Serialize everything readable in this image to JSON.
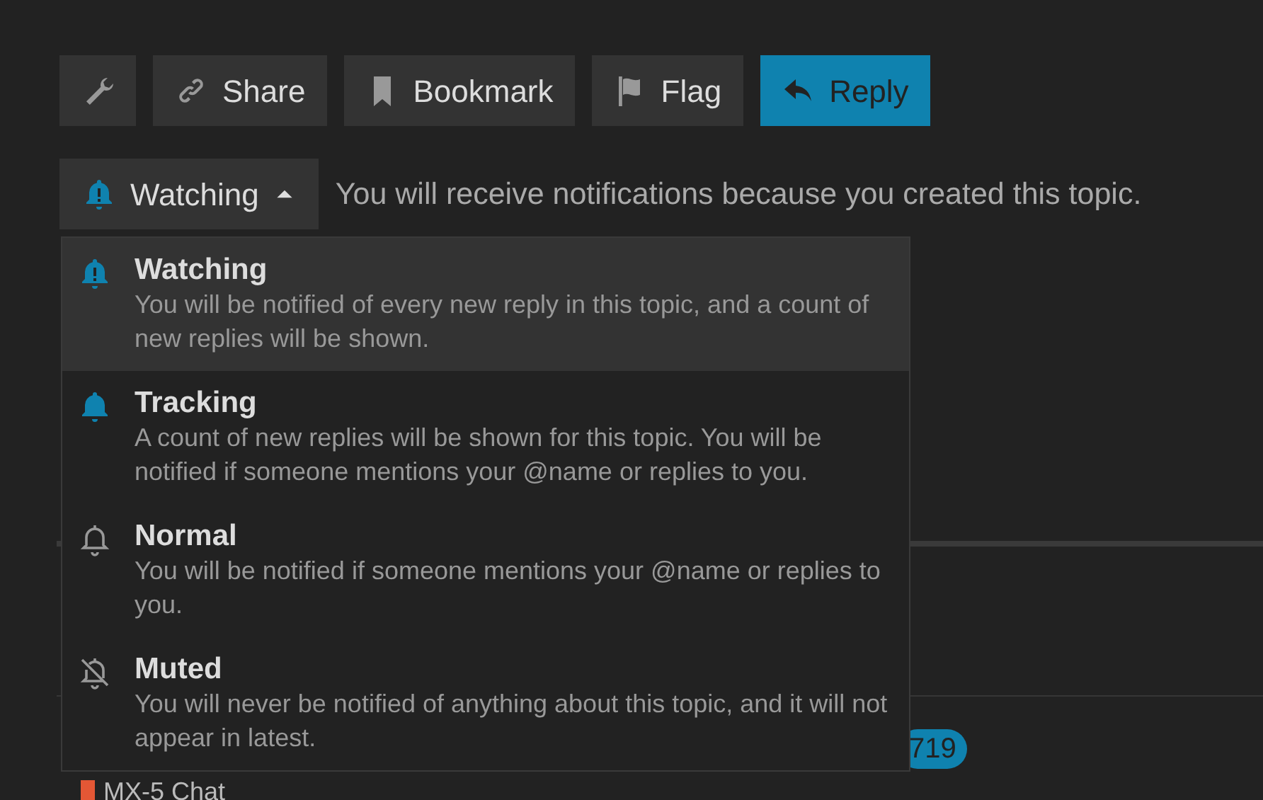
{
  "actions": [
    {
      "kind": "tools",
      "primary": false
    },
    {
      "kind": "share",
      "label": "Share",
      "primary": false
    },
    {
      "kind": "bookmark",
      "label": "Bookmark",
      "primary": false
    },
    {
      "kind": "flag",
      "label": "Flag",
      "primary": false
    },
    {
      "kind": "reply",
      "label": "Reply",
      "primary": true
    }
  ],
  "notifications": {
    "button": {
      "kind": "watching",
      "label": "Watching",
      "expanded": true
    },
    "reason": "You will receive notifications because you created this topic.",
    "menu": [
      {
        "kind": "watching",
        "title": "Watching",
        "description": "You will be notified of every new reply in this topic, and a count of new replies will be shown.",
        "selected": true
      },
      {
        "kind": "tracking",
        "title": "Tracking",
        "description": "A count of new replies will be shown for this topic. You will be notified if someone mentions your @name or replies to you.",
        "selected": false
      },
      {
        "kind": "normal",
        "title": "Normal",
        "description": "You will be notified if someone mentions your @name or replies to you.",
        "selected": false
      },
      {
        "kind": "muted",
        "title": "Muted",
        "description": "You will never be notified of anything about this topic, and it will not appear in latest.",
        "selected": false
      }
    ]
  },
  "background": {
    "badge": "719",
    "category": {
      "name": "MX-5 Chat",
      "color": "#e45735"
    }
  }
}
